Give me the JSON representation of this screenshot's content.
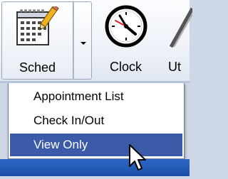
{
  "toolbar": {
    "buttons": [
      {
        "label": "Sched",
        "icon": "calendar-pencil-icon"
      },
      {
        "label": "Clock",
        "icon": "clock-icon"
      },
      {
        "label": "Ut",
        "icon": "utilities-icon"
      }
    ],
    "dropdown_icon": "chevron-down-icon"
  },
  "menu": {
    "items": [
      {
        "label": "Appointment List"
      },
      {
        "label": "Check In/Out"
      },
      {
        "label": "View Only",
        "highlighted": true
      }
    ]
  },
  "colors": {
    "menu_highlight": "#3b5aa8",
    "taskbar": "#2d67c4"
  }
}
